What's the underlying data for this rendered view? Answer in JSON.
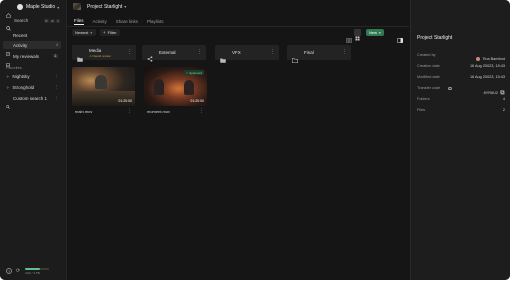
{
  "workspace": {
    "name": "Maple Studio"
  },
  "sidebar": {
    "search_label": "Search",
    "search_shortcut": [
      "⌘",
      "alt",
      "K"
    ],
    "items": [
      {
        "label": "Recent",
        "count": ""
      },
      {
        "label": "Activity",
        "count": "4"
      },
      {
        "label": "My reviewals",
        "count": "1"
      }
    ],
    "favorites_header": "Favorites",
    "favorites": [
      {
        "label": "Nightsky"
      },
      {
        "label": "Stronghold"
      },
      {
        "label": "Custom search 1"
      }
    ],
    "storage_text": "4.01 / 1 TB",
    "storage_fraction": 0.62
  },
  "project": {
    "title": "Project Starlight"
  },
  "tabs": [
    {
      "label": "Files",
      "active": true
    },
    {
      "label": "Activity",
      "active": false
    },
    {
      "label": "Share links",
      "active": false
    },
    {
      "label": "Playlists",
      "active": false
    }
  ],
  "toolbar": {
    "sort_label": "Newest",
    "filter_label": "Filter",
    "new_label": "New"
  },
  "folders": [
    {
      "name": "Media",
      "sub": "⚠ Needs review"
    },
    {
      "name": "External",
      "sub": ""
    },
    {
      "name": "VFX",
      "sub": ""
    },
    {
      "name": "Final",
      "sub": ""
    }
  ],
  "cards": [
    {
      "name": "main.mov",
      "duration": "01:20:00",
      "badge": ""
    },
    {
      "name": "moment.mov",
      "duration": "01:20:00",
      "badge": "Approved"
    }
  ],
  "details": {
    "title": "Project Starlight",
    "rows": [
      {
        "key": "Created by",
        "value": "Tina Bamford"
      },
      {
        "key": "Creation date",
        "value": "16 Aug 20023, 15:43"
      },
      {
        "key": "Modified date",
        "value": "16 Aug 20023, 15:43"
      },
      {
        "key": "Transfer code",
        "value": "8YR6U2"
      },
      {
        "key": "Folders",
        "value": "4"
      },
      {
        "key": "Files",
        "value": "2"
      }
    ]
  },
  "colors": {
    "accent_green": "#2f7a4f",
    "warning": "#c9a34a"
  }
}
